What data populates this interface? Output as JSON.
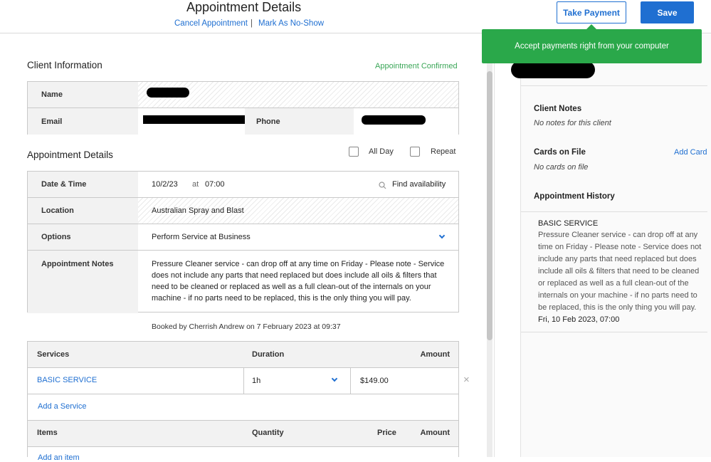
{
  "header": {
    "title": "Appointment Details",
    "cancel_link": "Cancel Appointment",
    "separator": "|",
    "no_show_link": "Mark As No-Show",
    "take_payment": "Take Payment",
    "save": "Save"
  },
  "toast": {
    "message": "Accept payments right from your computer"
  },
  "client": {
    "section_title": "Client Information",
    "status": "Appointment Confirmed",
    "name_label": "Name",
    "email_label": "Email",
    "phone_label": "Phone"
  },
  "appointment": {
    "section_title": "Appointment Details",
    "all_day_label": "All Day",
    "repeat_label": "Repeat",
    "date_time_label": "Date & Time",
    "date": "10/2/23",
    "at": "at",
    "time": "07:00",
    "find_availability": "Find availability",
    "location_label": "Location",
    "location": "Australian Spray and Blast",
    "options_label": "Options",
    "option_value": "Perform Service at Business",
    "notes_label": "Appointment Notes",
    "notes": "Pressure Cleaner service - can drop off at any time on Friday - Please note - Service does not include any parts that need replaced but does include all oils & filters that need to be cleaned or replaced as well as a full clean-out of the internals on your machine - if no parts need to be replaced, this is the only thing you will pay.",
    "booked_by": "Booked by Cherrish Andrew on 7 February 2023 at 09:37"
  },
  "services": {
    "headers": [
      "Services",
      "Duration",
      "Amount"
    ],
    "rows": [
      {
        "name": "BASIC SERVICE",
        "duration": "1h",
        "amount": "$149.00"
      }
    ],
    "add_service": "Add a Service",
    "remove_symbol": "×"
  },
  "items": {
    "headers": [
      "Items",
      "Quantity",
      "Price",
      "Amount"
    ],
    "add_item": "Add an item"
  },
  "right_panel": {
    "client_notes_title": "Client Notes",
    "client_notes_value": "No notes for this client",
    "cards_title": "Cards on File",
    "add_card": "Add Card",
    "cards_value": "No cards on file",
    "history_title": "Appointment History",
    "history": [
      {
        "service": "BASIC SERVICE",
        "description": "Pressure Cleaner service - can drop off at any time on Friday - Please note - Service does not include any parts that need replaced but does include all oils & filters that need to be cleaned or replaced as well as a full clean-out of the internals on your machine - if no parts need to be replaced, this is the only thing you will pay.",
        "date": "Fri, 10 Feb 2023, 07:00"
      }
    ]
  },
  "colors": {
    "accent": "#1f6fd1",
    "toast": "#2aa84a",
    "confirmed": "#3aa657"
  }
}
